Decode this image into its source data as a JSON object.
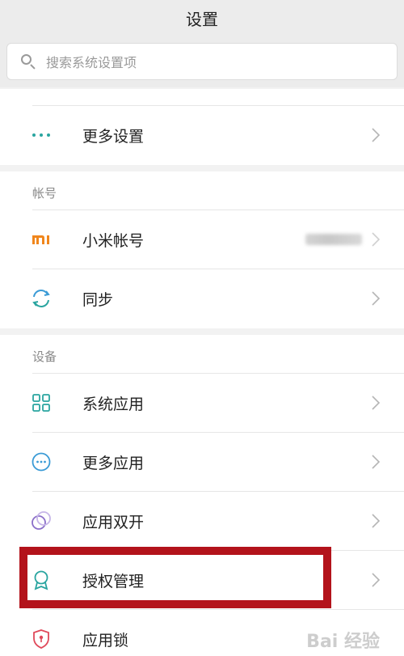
{
  "header": {
    "title": "设置"
  },
  "search": {
    "placeholder": "搜索系统设置项"
  },
  "colors": {
    "accent_teal": "#2aa5a0",
    "mi_orange": "#f0861c",
    "highlight_red": "#b3131b"
  },
  "section_misc": {
    "items": [
      {
        "label": "更多设置",
        "icon": "more-dots-icon"
      }
    ]
  },
  "section_account": {
    "header": "帐号",
    "items": [
      {
        "label": "小米帐号",
        "icon": "mi-logo-icon"
      },
      {
        "label": "同步",
        "icon": "sync-icon"
      }
    ]
  },
  "section_device": {
    "header": "设备",
    "items": [
      {
        "label": "系统应用",
        "icon": "grid-apps-icon"
      },
      {
        "label": "更多应用",
        "icon": "more-apps-icon"
      },
      {
        "label": "应用双开",
        "icon": "dual-apps-icon"
      },
      {
        "label": "授权管理",
        "icon": "permission-badge-icon"
      },
      {
        "label": "应用锁",
        "icon": "shield-lock-icon"
      }
    ]
  },
  "watermark": {
    "text": "Bai 经验"
  }
}
